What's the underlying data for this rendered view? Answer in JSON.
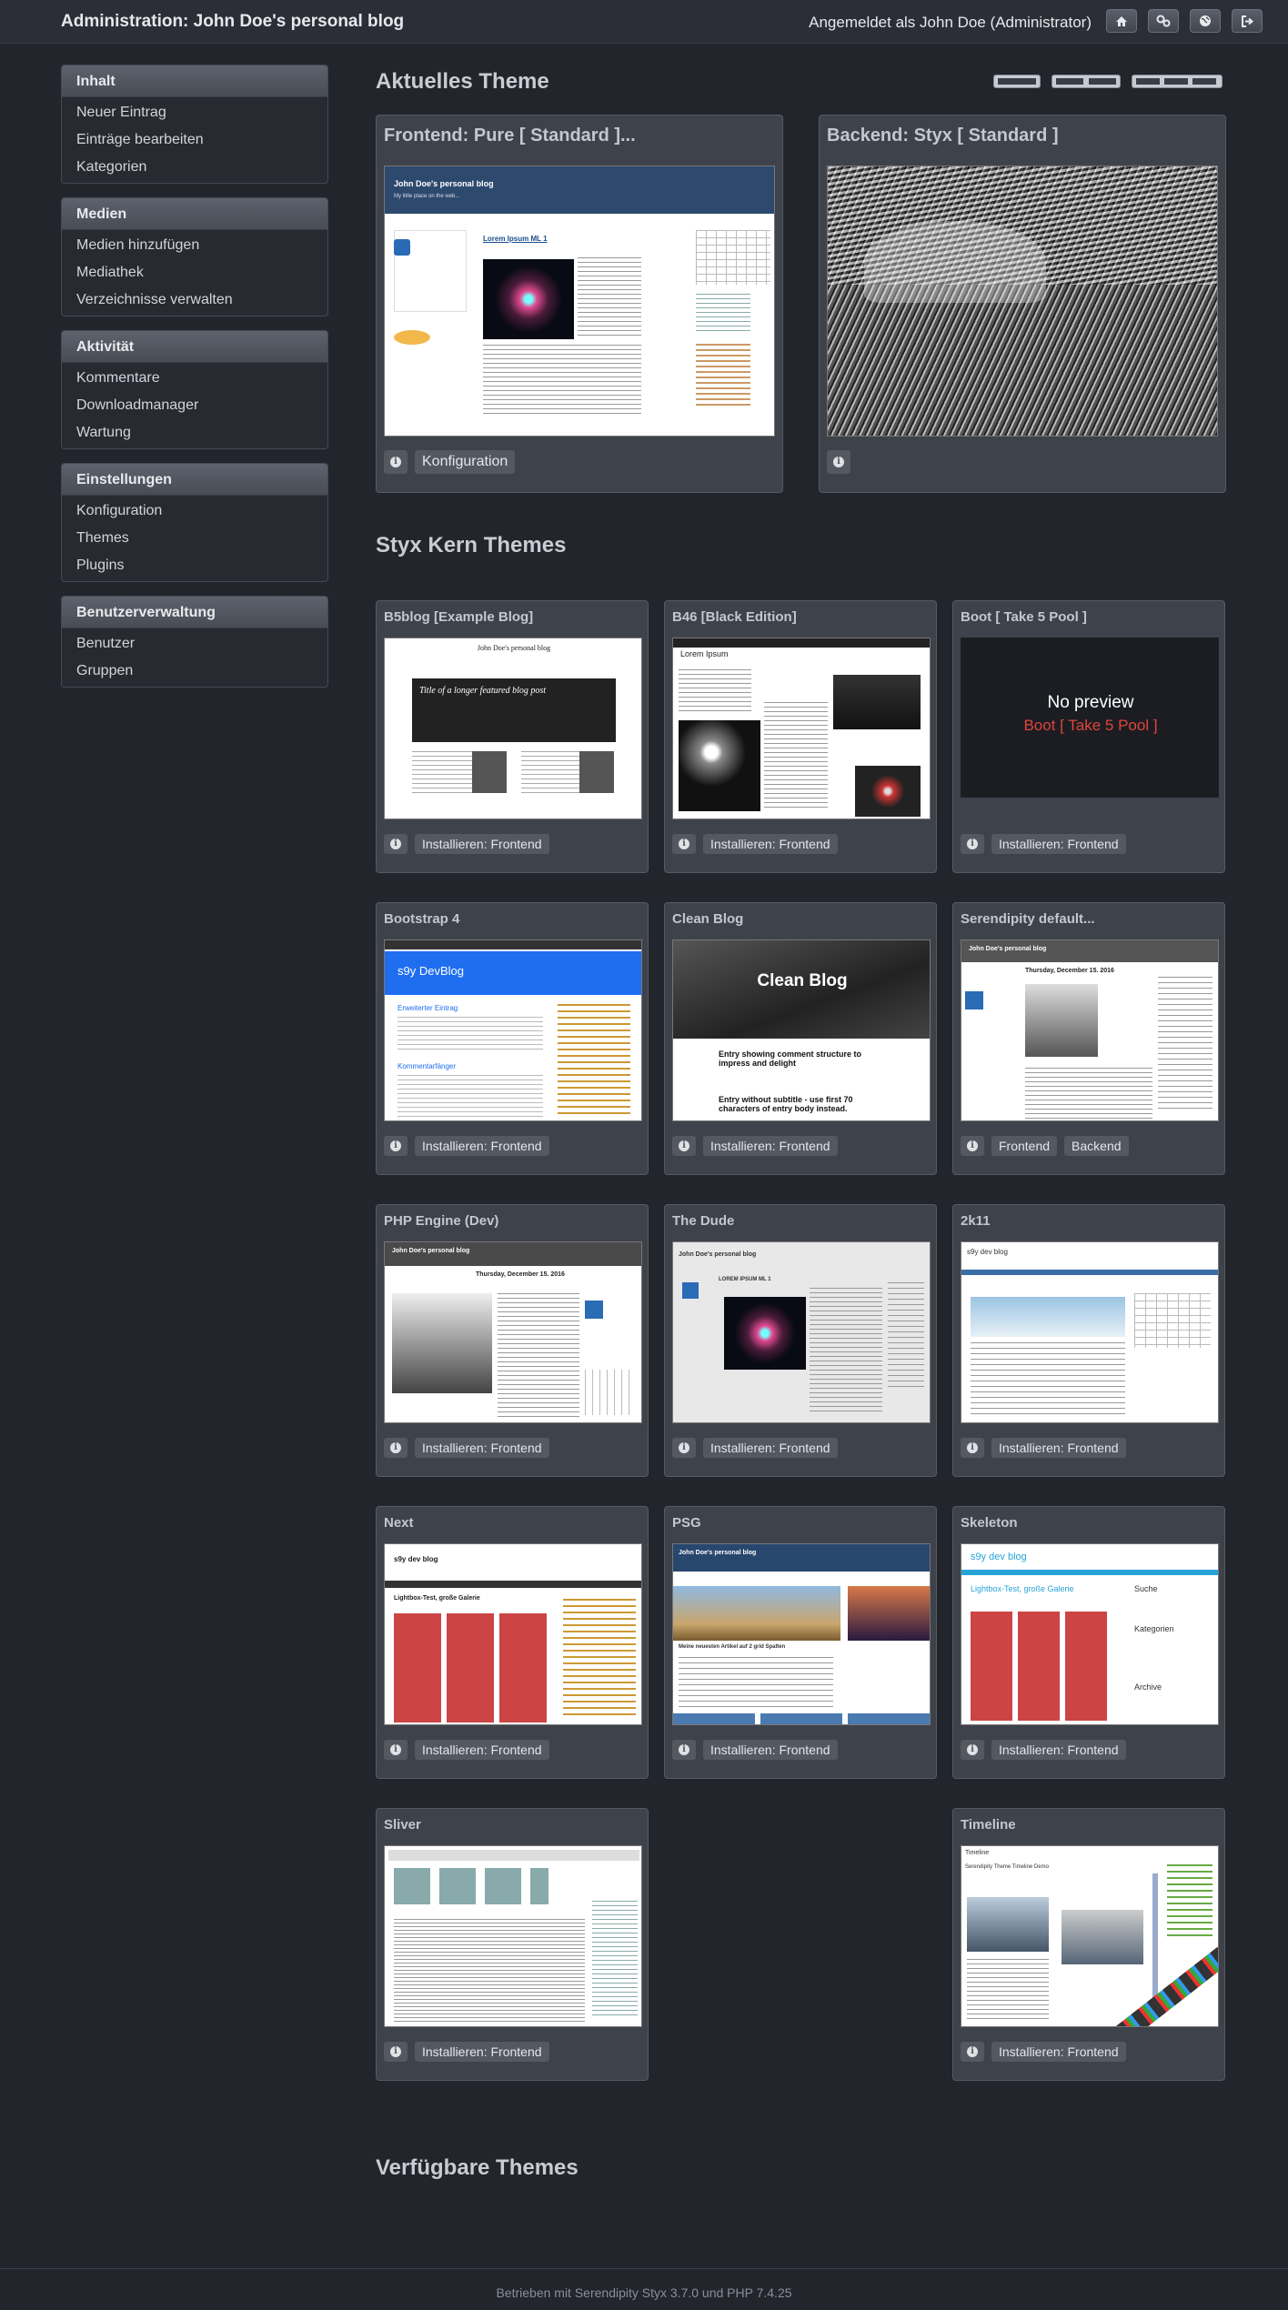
{
  "header": {
    "title": "Administration: John Doe's personal blog",
    "user": "Angemeldet als John Doe (Administrator)",
    "buttons": [
      "home-icon",
      "settings-icon",
      "globe-icon",
      "logout-icon"
    ]
  },
  "sidebar": {
    "groups": [
      {
        "title": "Inhalt",
        "items": [
          "Neuer Eintrag",
          "Einträge bearbeiten",
          "Kategorien"
        ]
      },
      {
        "title": "Medien",
        "items": [
          "Medien hinzufügen",
          "Mediathek",
          "Verzeichnisse verwalten"
        ]
      },
      {
        "title": "Aktivität",
        "items": [
          "Kommentare",
          "Downloadmanager",
          "Wartung"
        ]
      },
      {
        "title": "Einstellungen",
        "items": [
          "Konfiguration",
          "Themes",
          "Plugins"
        ]
      },
      {
        "title": "Benutzerverwaltung",
        "items": [
          "Benutzer",
          "Gruppen"
        ]
      }
    ]
  },
  "current": {
    "heading": "Aktuelles Theme",
    "frontend_title": "Frontend: Pure [ Standard ]...",
    "frontend_config": "Konfiguration",
    "backend_title": "Backend: Styx [ Standard ]",
    "frontend_shot": {
      "blog_title": "John Doe's personal blog",
      "blog_tagline": "My little place on the web...",
      "entry_title": "Lorem Ipsum ML 1"
    }
  },
  "core": {
    "heading": "Styx Kern Themes",
    "install_label": "Installieren: Frontend",
    "frontend_label": "Frontend",
    "backend_label": "Backend",
    "themes": [
      {
        "name": "B5blog [Example Blog]",
        "shot": "b5blog"
      },
      {
        "name": "B46 [Black Edition]",
        "shot": "b46"
      },
      {
        "name": "Boot [ Take 5 Pool ]",
        "shot": "boot"
      },
      {
        "name": "Bootstrap 4",
        "shot": "bootstrap4"
      },
      {
        "name": "Clean Blog",
        "shot": "cleanblog"
      },
      {
        "name": "Serendipity default...",
        "shot": "default"
      },
      {
        "name": "PHP Engine (Dev)",
        "shot": "phpengine"
      },
      {
        "name": "The Dude",
        "shot": "dude"
      },
      {
        "name": "2k11",
        "shot": "2k11"
      },
      {
        "name": "Next",
        "shot": "next"
      },
      {
        "name": "PSG",
        "shot": "psg"
      },
      {
        "name": "Skeleton",
        "shot": "skeleton"
      },
      {
        "name": "Sliver",
        "shot": "sliver"
      },
      {
        "name": "Timeline",
        "shot": "timeline"
      }
    ],
    "boot_preview": {
      "line1": "No preview",
      "line2": "Boot [ Take 5 Pool ]"
    },
    "shot_text": {
      "b5_blog": "John Doe's personal blog",
      "b5_post": "Title of a longer featured blog post",
      "b46_title": "Lorem Ipsum",
      "bs4_title": "s9y DevBlog",
      "bs4_entry": "Erweiterter Eintrag",
      "bs4_comments": "Kommentarfänger",
      "clean_title": "Clean Blog",
      "clean_e1": "Entry showing comment structure to impress and delight",
      "clean_e2": "Entry without subtitle - use first 70 characters of entry body instead.",
      "default_blog": "John Doe's personal blog",
      "default_date": "Thursday, December 15. 2016",
      "php_blog": "John Doe's personal blog",
      "php_date": "Thursday, December 15. 2016",
      "dude_blog": "John Doe's personal blog",
      "dude_entry": "LOREM IPSUM ML 1",
      "k11_blog": "s9y dev blog",
      "next_blog": "s9y dev blog",
      "next_entry": "Lightbox-Test, große Galerie",
      "psg_blog": "John Doe's personal blog",
      "psg_entry": "Meine neuesten Artikel auf 2 grid Spalten",
      "skel_blog": "s9y dev blog",
      "skel_entry": "Lightbox-Test, große Galerie",
      "skel_search": "Suche",
      "skel_cat": "Kategorien",
      "skel_archive": "Archive",
      "tl_title": "Timeline",
      "tl_sub": "Serendipity Theme Timeline Demo"
    }
  },
  "available": {
    "heading": "Verfügbare Themes"
  },
  "footer": {
    "text": "Betrieben mit Serendipity Styx 3.7.0 und PHP 7.4.25"
  }
}
